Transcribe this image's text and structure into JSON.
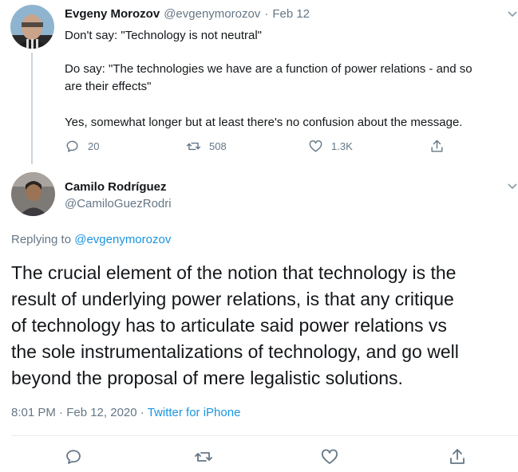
{
  "parent_tweet": {
    "author_name": "Evgeny Morozov",
    "author_handle": "@evgenymorozov",
    "separator": "·",
    "date": "Feb 12",
    "lines": [
      "Don't say: \"Technology is not neutral\"",
      "Do say: \"The technologies we have are a function of power relations - and so",
      "are their effects\"",
      "Yes, somewhat longer but at least there's no confusion about the message."
    ],
    "replies": "20",
    "retweets": "508",
    "likes": "1.3K"
  },
  "reply_tweet": {
    "author_name": "Camilo Rodríguez",
    "author_handle": "@CamiloGuezRodri",
    "replying_prefix": "Replying to",
    "replying_to": "@evgenymorozov",
    "lines": [
      "The crucial element of the notion that technology is the",
      "result of underlying power relations, is that any critique",
      "of technology has to articulate said power relations vs",
      "the sole instrumentalizations of technology, and go well",
      "beyond the proposal of mere legalistic solutions."
    ],
    "timestamp": "8:01 PM · Feb 12, 2020",
    "separator": "·",
    "source": "Twitter for iPhone"
  },
  "icons": {
    "reply": "reply-icon",
    "retweet": "retweet-icon",
    "like": "heart-icon",
    "share": "share-icon",
    "caret": "chevron-down-icon"
  },
  "colors": {
    "text": "#14171a",
    "muted": "#657786",
    "link": "#1b95e0",
    "line": "#ccd6dd"
  }
}
